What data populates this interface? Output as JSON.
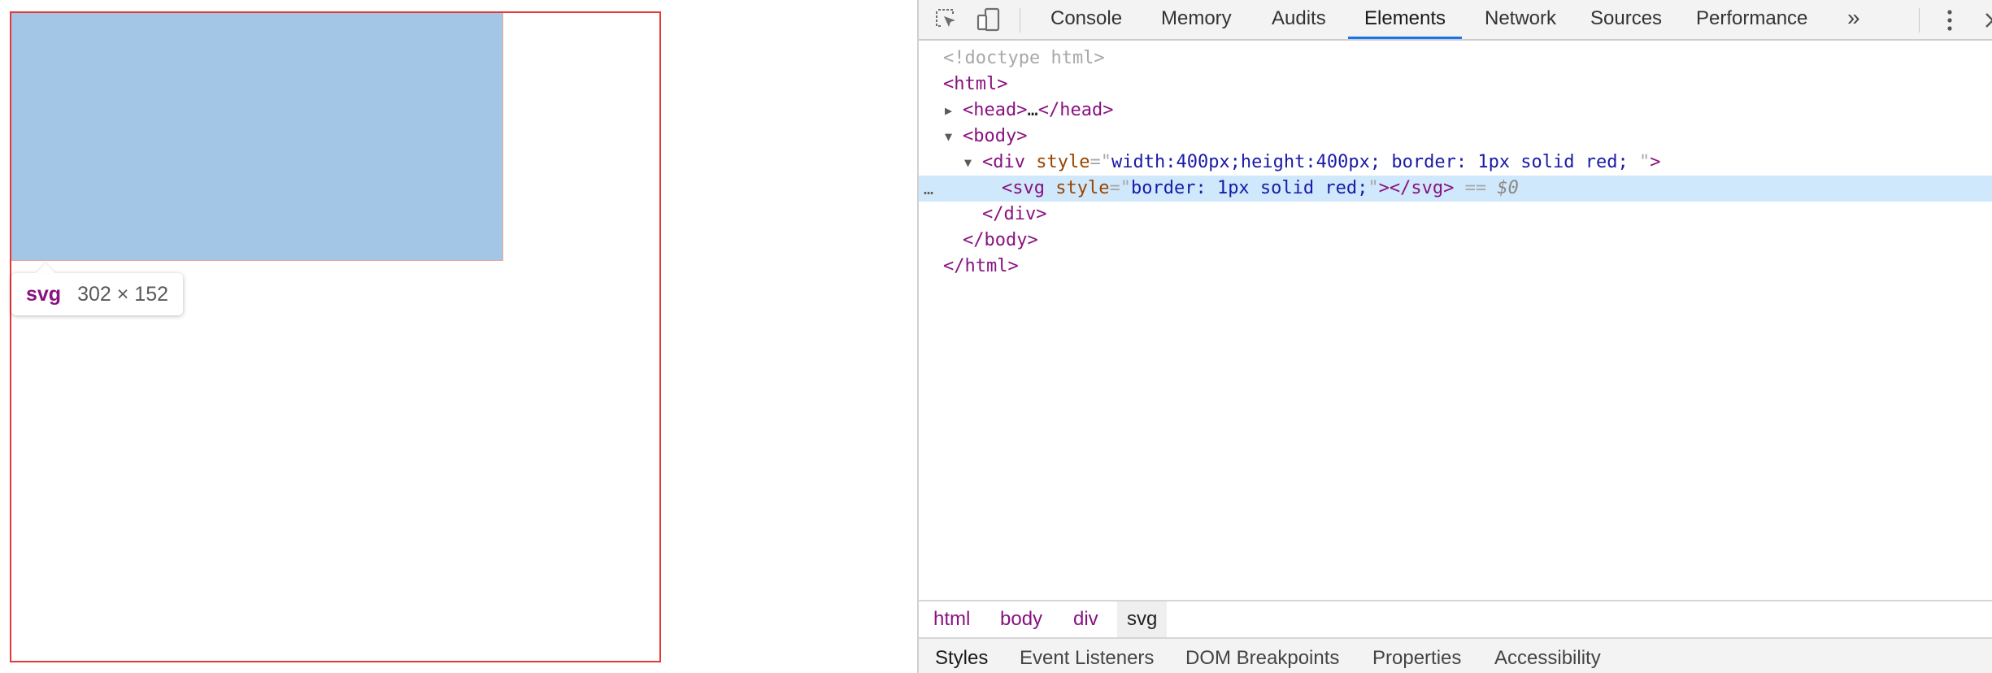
{
  "tooltip": {
    "tag": "svg",
    "size": "302 × 152"
  },
  "devtools": {
    "tabs": [
      {
        "label": "Console"
      },
      {
        "label": "Memory"
      },
      {
        "label": "Audits"
      },
      {
        "label": "Elements"
      },
      {
        "label": "Network"
      },
      {
        "label": "Sources"
      },
      {
        "label": "Performance"
      }
    ],
    "more_tabs": "»",
    "dom": {
      "doctype": "<!doctype html>",
      "html_open": "<html>",
      "head_collapsed": {
        "open": "<head>",
        "ellipsis": "…",
        "close": "</head>"
      },
      "body_open": "<body>",
      "div_tag": "div",
      "attr_style": "style",
      "div_style": "width:400px;height:400px; border: 1px solid red; ",
      "svg_tag": "svg",
      "svg_style": "border: 1px solid red;",
      "svg_close": "</svg>",
      "selected_marker": "==",
      "selected_var": "$0",
      "div_close": "</div>",
      "body_close": "</body>",
      "html_close": "</html>",
      "dots": "…"
    },
    "breadcrumbs": [
      "html",
      "body",
      "div",
      "svg"
    ],
    "bottom_tabs": [
      "Styles",
      "Event Listeners",
      "DOM Breakpoints",
      "Properties",
      "Accessibility"
    ]
  },
  "colors": {
    "highlight": "#a4c6e6",
    "border_red": "#e53935",
    "active_tab": "#1a73e8",
    "selected_row": "#cfe8fc",
    "tag": "#881280"
  }
}
